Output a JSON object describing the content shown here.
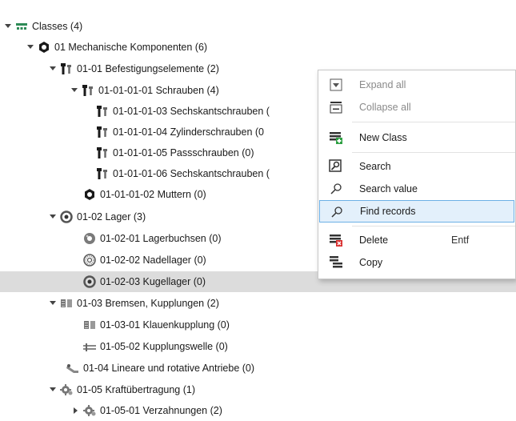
{
  "tree": {
    "root": "Classes (4)",
    "n1": "01 Mechanische Komponenten (6)",
    "n2": "01-01 Befestigungselemente (2)",
    "n3": "01-01-01-01 Schrauben (4)",
    "n4": "01-01-01-03 Sechskantschrauben (",
    "n5": "01-01-01-04 Zylinderschrauben (0",
    "n6": "01-01-01-05 Passschrauben (0)",
    "n7": "01-01-01-06 Sechskantschrauben (",
    "n8": "01-01-01-02 Muttern (0)",
    "n9": "01-02 Lager (3)",
    "n10": "01-02-01 Lagerbuchsen (0)",
    "n11": "01-02-02 Nadellager (0)",
    "n12": "01-02-03 Kugellager (0)",
    "n13": "01-03 Bremsen, Kupplungen (2)",
    "n14": "01-03-01 Klauenkupplung (0)",
    "n15": "01-05-02 Kupplungswelle (0)",
    "n16": "01-04 Lineare und rotative Antriebe (0)",
    "n17": "01-05 Kraftübertragung (1)",
    "n18": "01-05-01 Verzahnungen (2)",
    "selected": "01-02-03 Kugellager (0)"
  },
  "context_menu": {
    "expand_all": "Expand all",
    "collapse_all": "Collapse all",
    "new_class": "New Class",
    "search": "Search",
    "search_value": "Search value",
    "find_records": "Find records",
    "delete": "Delete",
    "delete_shortcut": "Entf",
    "copy": "Copy",
    "highlighted": "Find records"
  },
  "colors": {
    "selection": "#dcdcdc",
    "menu_highlight": "#e3f0fb",
    "menu_highlight_border": "#6cb0e6",
    "root_icon": "#2e8b57",
    "new_icon_accent": "#2ea043",
    "delete_icon_accent": "#d93030"
  }
}
